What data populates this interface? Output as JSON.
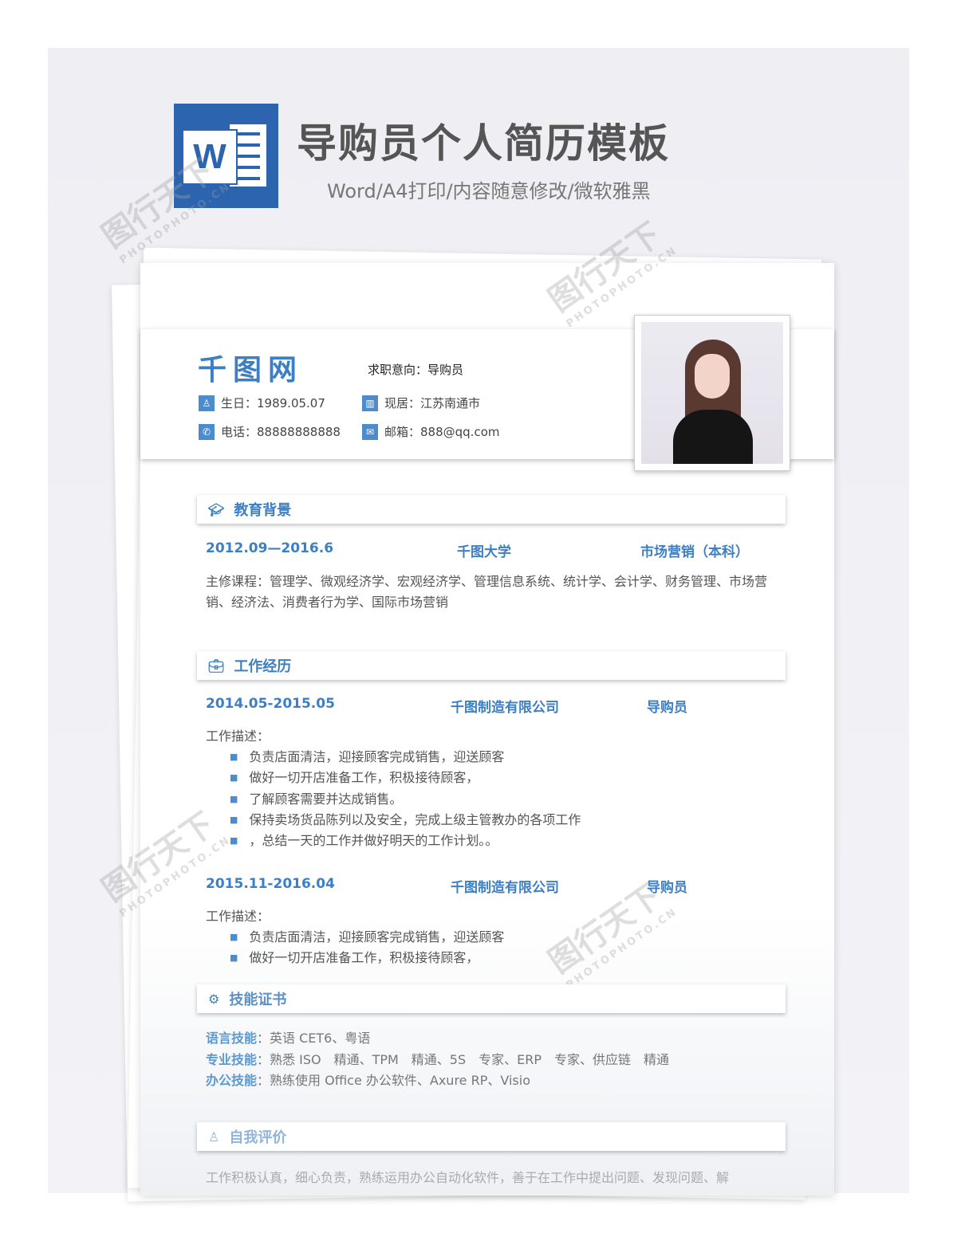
{
  "banner": {
    "title": "导购员个人简历模板",
    "subtitle": "Word/A4打印/内容随意修改/微软雅黑",
    "logo_letter": "W"
  },
  "header": {
    "name": "千图网",
    "intent": "求职意向：导购员",
    "birth": "生日：1989.05.07",
    "residence": "现居：江苏南通市",
    "phone": "电话：88888888888",
    "email": "邮箱：888@qq.com"
  },
  "education": {
    "title": "教育背景",
    "period": "2012.09—2016.6",
    "school": "千图大学",
    "major": "市场营销（本科）",
    "courses": "主修课程：管理学、微观经济学、宏观经济学、管理信息系统、统计学、会计学、财务管理、市场营销、经济法、消费者行为学、国际市场营销"
  },
  "work": {
    "title": "工作经历",
    "jobs": [
      {
        "period": "2014.05-2015.05",
        "company": "千图制造有限公司",
        "role": "导购员",
        "desc_label": "工作描述：",
        "items": [
          "负责店面清洁，迎接顾客完成销售，迎送顾客",
          "做好一切开店准备工作，积极接待顾客，",
          "了解顾客需要并达成销售。",
          "保持卖场货品陈列以及安全，完成上级主管教办的各项工作",
          "，总结一天的工作并做好明天的工作计划。。"
        ]
      },
      {
        "period": "2015.11-2016.04",
        "company": "千图制造有限公司",
        "role": "导购员",
        "desc_label": "工作描述：",
        "items": [
          "负责店面清洁，迎接顾客完成销售，迎送顾客",
          "做好一切开店准备工作，积极接待顾客，"
        ]
      }
    ]
  },
  "skills": {
    "title": "技能证书",
    "items": [
      {
        "label": "语言技能",
        "value": "：英语 CET6、粤语"
      },
      {
        "label": "专业技能",
        "value": "：熟悉 ISO　精通、TPM　精通、5S　专家、ERP　专家、供应链　精通"
      },
      {
        "label": "办公技能",
        "value": "：熟练使用 Office  办公软件、Axure RP、Visio"
      }
    ]
  },
  "self": {
    "title": "自我评价",
    "text": "工作积极认真，细心负责，熟练运用办公自动化软件，善于在工作中提出问题、发现问题、解"
  },
  "watermark": {
    "text": "图行天下",
    "sub": "PHOTOPHOTO.CN"
  },
  "colors": {
    "accent": "#3d7fc4",
    "word_blue": "#2d64b0"
  }
}
